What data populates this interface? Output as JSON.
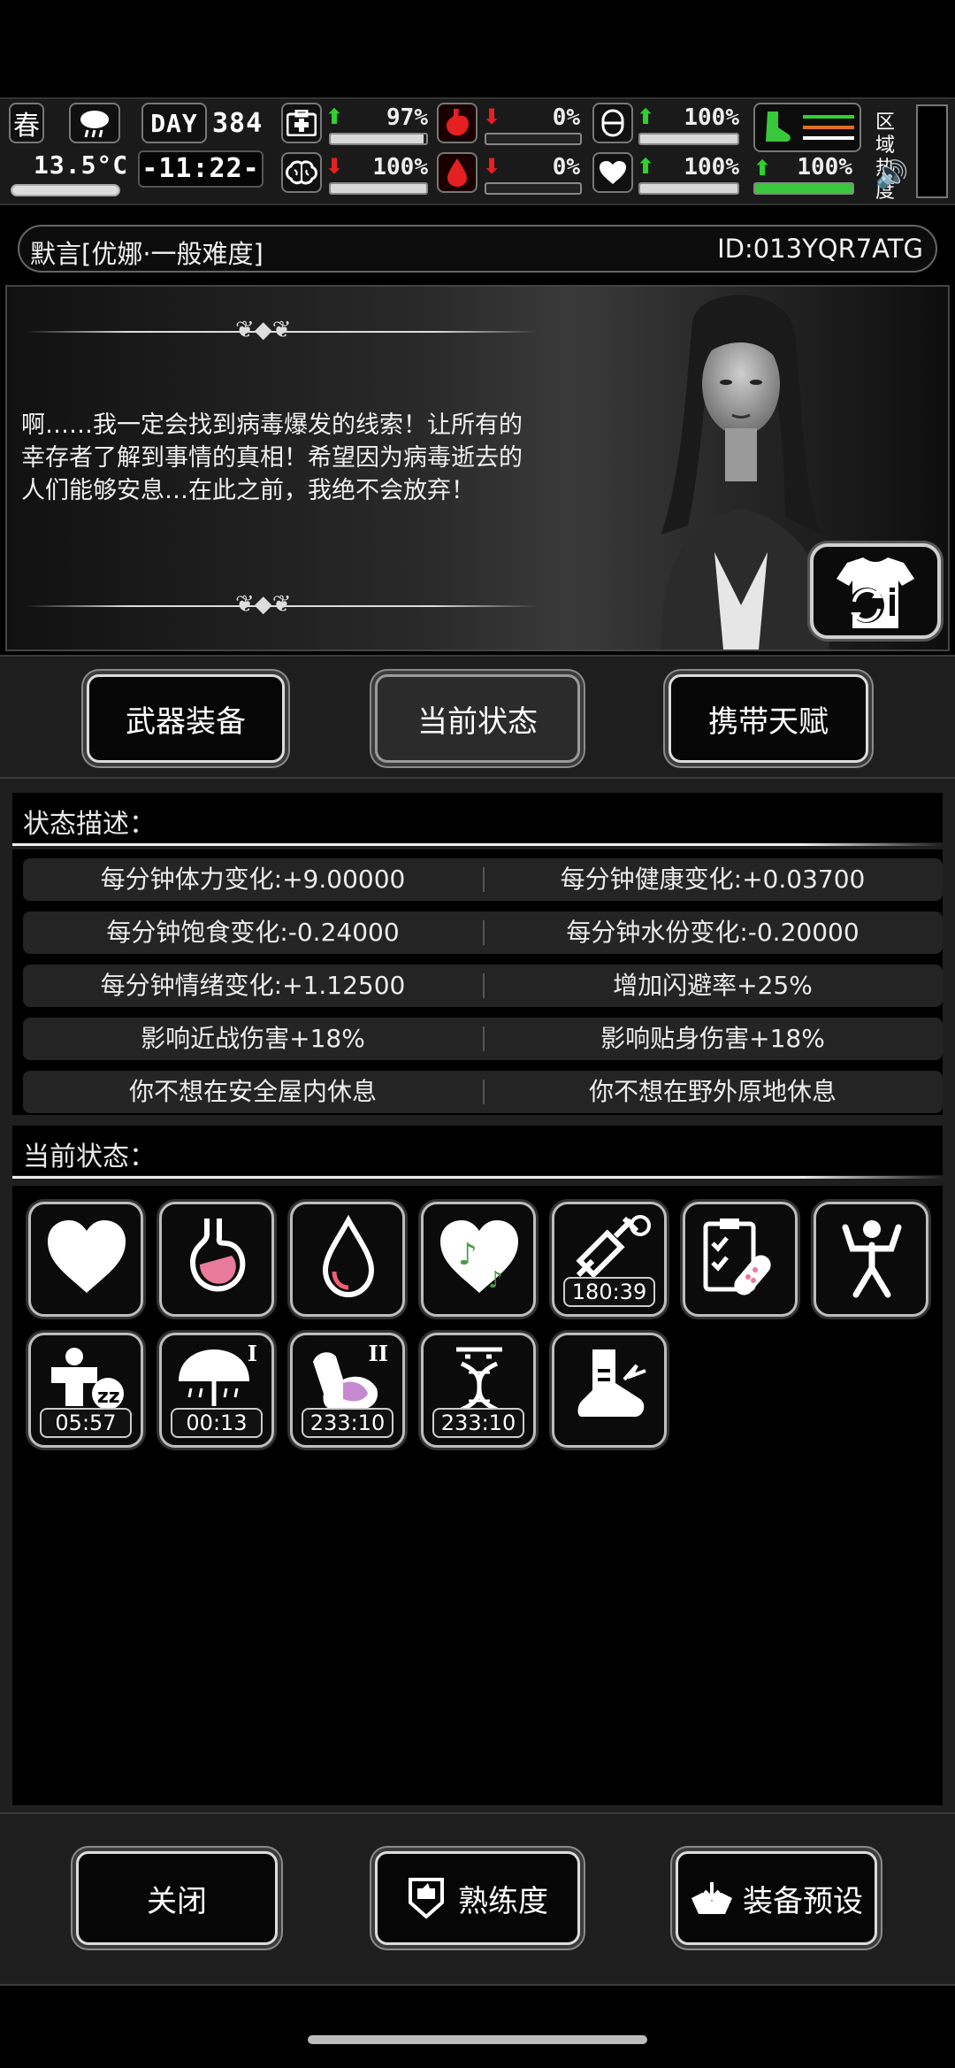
{
  "status_bar": {
    "season": "春",
    "temperature": "13.5°C",
    "day_label": "DAY",
    "day_number": "384",
    "time": "-11:22-",
    "health": {
      "value": "97%",
      "level": 0.97
    },
    "brain": {
      "value": "100%",
      "level": 1.0
    },
    "hunger": {
      "value": "0%",
      "level": 0.0
    },
    "blood": {
      "value": "0%",
      "level": 0.0
    },
    "stamina": {
      "value": "100%",
      "level": 1.0
    },
    "mood": {
      "value": "100%",
      "level": 1.0
    },
    "speed": {
      "value": "100%",
      "level": 1.0
    },
    "zone_heat_label": "区域热度",
    "colors": {
      "up": "#2fd12f",
      "down": "#e42020",
      "speed_bar": "#39c83c"
    }
  },
  "character": {
    "name": "默言[优娜·一般难度]",
    "id": "ID:013YQR7ATG",
    "quote": "啊……我一定会找到病毒爆发的线索！让所有的幸存者了解到事情的真相！希望因为病毒逝去的人们能够安息…在此之前，我绝不会放弃！"
  },
  "tabs": [
    "武器装备",
    "当前状态",
    "携带天赋"
  ],
  "selected_tab": "当前状态",
  "status_description": {
    "title": "状态描述：",
    "rows": [
      [
        "每分钟体力变化:+9.00000",
        "每分钟健康变化:+0.03700"
      ],
      [
        "每分钟饱食变化:-0.24000",
        "每分钟水份变化:-0.20000"
      ],
      [
        "每分钟情绪变化:+1.12500",
        "增加闪避率+25%"
      ],
      [
        "影响近战伤害+18%",
        "影响贴身伤害+18%"
      ],
      [
        "你不想在安全屋内休息",
        "你不想在野外原地休息"
      ]
    ]
  },
  "current_status": {
    "title": "当前状态：",
    "effects": [
      {
        "icon": "heart-icon",
        "timer": "",
        "rank": ""
      },
      {
        "icon": "stomach-icon",
        "timer": "",
        "rank": ""
      },
      {
        "icon": "water-drop-icon",
        "timer": "",
        "rank": ""
      },
      {
        "icon": "music-heart-icon",
        "timer": "",
        "rank": ""
      },
      {
        "icon": "syringe-icon",
        "timer": "180:39",
        "rank": ""
      },
      {
        "icon": "medical-kit-icon",
        "timer": "",
        "rank": ""
      },
      {
        "icon": "strong-man-icon",
        "timer": "",
        "rank": ""
      },
      {
        "icon": "sleeping-man-icon",
        "timer": "05:57",
        "rank": ""
      },
      {
        "icon": "umbrella-icon",
        "timer": "00:13",
        "rank": "I"
      },
      {
        "icon": "arm-icon",
        "timer": "233:10",
        "rank": "II"
      },
      {
        "icon": "dna-man-icon",
        "timer": "233:10",
        "rank": ""
      },
      {
        "icon": "fast-foot-icon",
        "timer": "",
        "rank": ""
      }
    ]
  },
  "bottom_buttons": {
    "close": "关闭",
    "proficiency": "熟练度",
    "equip_preset": "装备预设"
  }
}
